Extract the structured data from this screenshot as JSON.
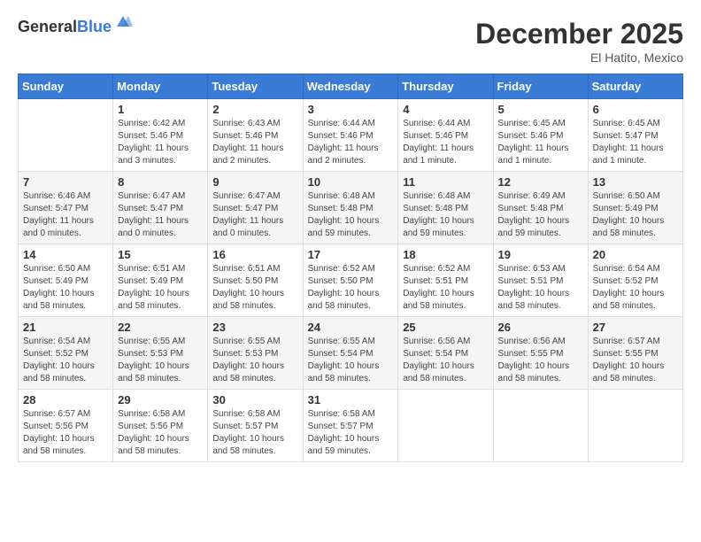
{
  "header": {
    "logo_general": "General",
    "logo_blue": "Blue",
    "month": "December 2025",
    "location": "El Hatito, Mexico"
  },
  "days_of_week": [
    "Sunday",
    "Monday",
    "Tuesday",
    "Wednesday",
    "Thursday",
    "Friday",
    "Saturday"
  ],
  "weeks": [
    [
      {
        "day": "",
        "info": ""
      },
      {
        "day": "1",
        "info": "Sunrise: 6:42 AM\nSunset: 5:46 PM\nDaylight: 11 hours\nand 3 minutes."
      },
      {
        "day": "2",
        "info": "Sunrise: 6:43 AM\nSunset: 5:46 PM\nDaylight: 11 hours\nand 2 minutes."
      },
      {
        "day": "3",
        "info": "Sunrise: 6:44 AM\nSunset: 5:46 PM\nDaylight: 11 hours\nand 2 minutes."
      },
      {
        "day": "4",
        "info": "Sunrise: 6:44 AM\nSunset: 5:46 PM\nDaylight: 11 hours\nand 1 minute."
      },
      {
        "day": "5",
        "info": "Sunrise: 6:45 AM\nSunset: 5:46 PM\nDaylight: 11 hours\nand 1 minute."
      },
      {
        "day": "6",
        "info": "Sunrise: 6:45 AM\nSunset: 5:47 PM\nDaylight: 11 hours\nand 1 minute."
      }
    ],
    [
      {
        "day": "7",
        "info": "Sunrise: 6:46 AM\nSunset: 5:47 PM\nDaylight: 11 hours\nand 0 minutes."
      },
      {
        "day": "8",
        "info": "Sunrise: 6:47 AM\nSunset: 5:47 PM\nDaylight: 11 hours\nand 0 minutes."
      },
      {
        "day": "9",
        "info": "Sunrise: 6:47 AM\nSunset: 5:47 PM\nDaylight: 11 hours\nand 0 minutes."
      },
      {
        "day": "10",
        "info": "Sunrise: 6:48 AM\nSunset: 5:48 PM\nDaylight: 10 hours\nand 59 minutes."
      },
      {
        "day": "11",
        "info": "Sunrise: 6:48 AM\nSunset: 5:48 PM\nDaylight: 10 hours\nand 59 minutes."
      },
      {
        "day": "12",
        "info": "Sunrise: 6:49 AM\nSunset: 5:48 PM\nDaylight: 10 hours\nand 59 minutes."
      },
      {
        "day": "13",
        "info": "Sunrise: 6:50 AM\nSunset: 5:49 PM\nDaylight: 10 hours\nand 58 minutes."
      }
    ],
    [
      {
        "day": "14",
        "info": "Sunrise: 6:50 AM\nSunset: 5:49 PM\nDaylight: 10 hours\nand 58 minutes."
      },
      {
        "day": "15",
        "info": "Sunrise: 6:51 AM\nSunset: 5:49 PM\nDaylight: 10 hours\nand 58 minutes."
      },
      {
        "day": "16",
        "info": "Sunrise: 6:51 AM\nSunset: 5:50 PM\nDaylight: 10 hours\nand 58 minutes."
      },
      {
        "day": "17",
        "info": "Sunrise: 6:52 AM\nSunset: 5:50 PM\nDaylight: 10 hours\nand 58 minutes."
      },
      {
        "day": "18",
        "info": "Sunrise: 6:52 AM\nSunset: 5:51 PM\nDaylight: 10 hours\nand 58 minutes."
      },
      {
        "day": "19",
        "info": "Sunrise: 6:53 AM\nSunset: 5:51 PM\nDaylight: 10 hours\nand 58 minutes."
      },
      {
        "day": "20",
        "info": "Sunrise: 6:54 AM\nSunset: 5:52 PM\nDaylight: 10 hours\nand 58 minutes."
      }
    ],
    [
      {
        "day": "21",
        "info": "Sunrise: 6:54 AM\nSunset: 5:52 PM\nDaylight: 10 hours\nand 58 minutes."
      },
      {
        "day": "22",
        "info": "Sunrise: 6:55 AM\nSunset: 5:53 PM\nDaylight: 10 hours\nand 58 minutes."
      },
      {
        "day": "23",
        "info": "Sunrise: 6:55 AM\nSunset: 5:53 PM\nDaylight: 10 hours\nand 58 minutes."
      },
      {
        "day": "24",
        "info": "Sunrise: 6:55 AM\nSunset: 5:54 PM\nDaylight: 10 hours\nand 58 minutes."
      },
      {
        "day": "25",
        "info": "Sunrise: 6:56 AM\nSunset: 5:54 PM\nDaylight: 10 hours\nand 58 minutes."
      },
      {
        "day": "26",
        "info": "Sunrise: 6:56 AM\nSunset: 5:55 PM\nDaylight: 10 hours\nand 58 minutes."
      },
      {
        "day": "27",
        "info": "Sunrise: 6:57 AM\nSunset: 5:55 PM\nDaylight: 10 hours\nand 58 minutes."
      }
    ],
    [
      {
        "day": "28",
        "info": "Sunrise: 6:57 AM\nSunset: 5:56 PM\nDaylight: 10 hours\nand 58 minutes."
      },
      {
        "day": "29",
        "info": "Sunrise: 6:58 AM\nSunset: 5:56 PM\nDaylight: 10 hours\nand 58 minutes."
      },
      {
        "day": "30",
        "info": "Sunrise: 6:58 AM\nSunset: 5:57 PM\nDaylight: 10 hours\nand 58 minutes."
      },
      {
        "day": "31",
        "info": "Sunrise: 6:58 AM\nSunset: 5:57 PM\nDaylight: 10 hours\nand 59 minutes."
      },
      {
        "day": "",
        "info": ""
      },
      {
        "day": "",
        "info": ""
      },
      {
        "day": "",
        "info": ""
      }
    ]
  ]
}
